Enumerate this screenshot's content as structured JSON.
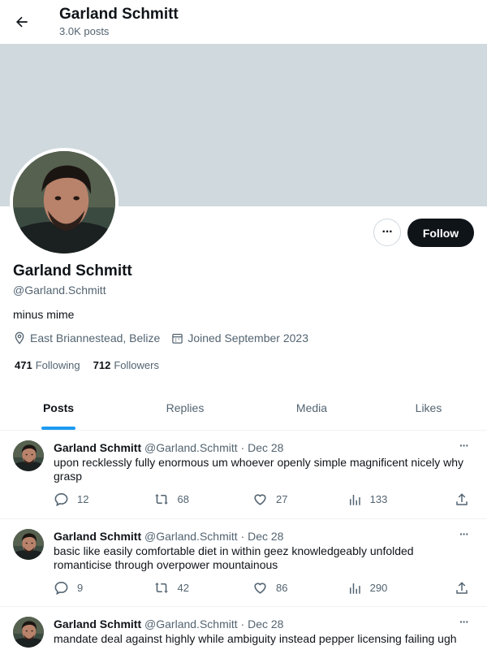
{
  "header": {
    "title": "Garland Schmitt",
    "subtitle": "3.0K posts"
  },
  "profile": {
    "name": "Garland Schmitt",
    "handle": "@Garland.Schmitt",
    "bio": "minus mime",
    "location": "East Briannestead, Belize",
    "joined": "Joined September 2023",
    "following_count": "471",
    "following_label": "Following",
    "followers_count": "712",
    "followers_label": "Followers",
    "follow_label": "Follow",
    "more_label": "···"
  },
  "tabs": [
    {
      "label": "Posts",
      "active": true
    },
    {
      "label": "Replies",
      "active": false
    },
    {
      "label": "Media",
      "active": false
    },
    {
      "label": "Likes",
      "active": false
    }
  ],
  "posts": [
    {
      "name": "Garland Schmitt",
      "handle": "@Garland.Schmitt",
      "dot": "·",
      "date": "Dec 28",
      "text": "upon recklessly fully enormous um whoever openly simple magnificent nicely why grasp",
      "replies": "12",
      "reposts": "68",
      "likes": "27",
      "views": "133",
      "more": "···"
    },
    {
      "name": "Garland Schmitt",
      "handle": "@Garland.Schmitt",
      "dot": "·",
      "date": "Dec 28",
      "text": "basic like easily comfortable diet in within geez knowledgeably unfolded romanticise through overpower mountainous",
      "replies": "9",
      "reposts": "42",
      "likes": "86",
      "views": "290",
      "more": "···"
    },
    {
      "name": "Garland Schmitt",
      "handle": "@Garland.Schmitt",
      "dot": "·",
      "date": "Dec 28",
      "text": "mandate deal against highly while ambiguity instead pepper licensing failing ugh",
      "more": "···"
    }
  ],
  "colors": {
    "accent": "#1d9bf0",
    "banner": "#cfd9de",
    "text": "#0f1419",
    "muted": "#536471"
  },
  "icons": {
    "back": "arrow-left-icon",
    "location": "map-pin-icon",
    "calendar": "calendar-icon",
    "reply": "reply-icon",
    "repost": "repost-icon",
    "like": "heart-icon",
    "views": "bar-chart-icon",
    "share": "share-icon"
  }
}
